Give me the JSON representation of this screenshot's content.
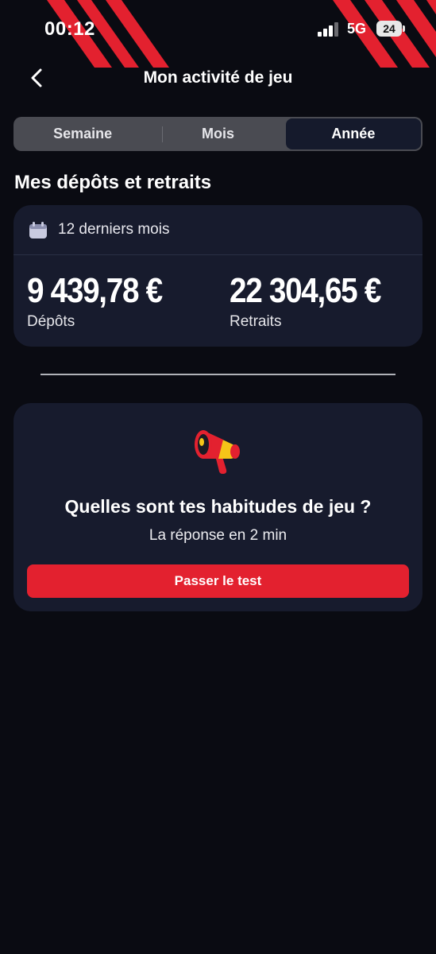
{
  "status_bar": {
    "time": "00:12",
    "network": "5G",
    "battery": "24"
  },
  "header": {
    "title": "Mon activité de jeu",
    "back_icon": "chevron-left-icon"
  },
  "tabs": [
    {
      "label": "Semaine",
      "active": false
    },
    {
      "label": "Mois",
      "active": false
    },
    {
      "label": "Année",
      "active": true
    }
  ],
  "section": {
    "title": "Mes dépôts et retraits"
  },
  "stats_card": {
    "period_icon": "calendar-icon",
    "period": "12 derniers mois",
    "deposits": {
      "value": "9 439,78 €",
      "label": "Dépôts"
    },
    "withdrawals": {
      "value": "22 304,65 €",
      "label": "Retraits"
    }
  },
  "quiz_card": {
    "icon": "megaphone-icon",
    "title": "Quelles sont tes habitudes de jeu ?",
    "subtitle": "La réponse en 2 min",
    "button": "Passer le test"
  },
  "colors": {
    "background": "#0a0b12",
    "card": "#171b2d",
    "accent_red": "#e3212f",
    "segment_bg": "#4a4b52",
    "segment_active": "#151a2c"
  }
}
